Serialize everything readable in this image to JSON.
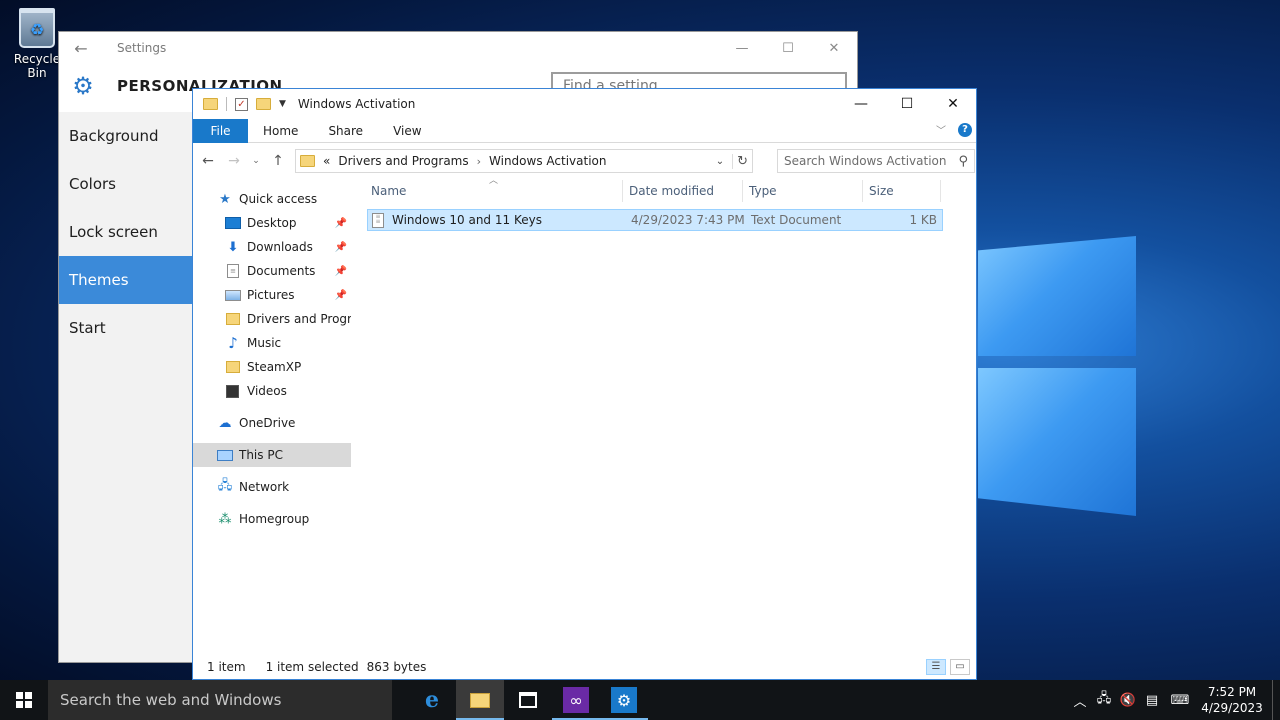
{
  "desktop": {
    "recycle_label": "Recycle Bin"
  },
  "settings": {
    "title": "Settings",
    "heading": "PERSONALIZATION",
    "search_placeholder": "Find a setting",
    "nav": [
      {
        "label": "Background"
      },
      {
        "label": "Colors"
      },
      {
        "label": "Lock screen"
      },
      {
        "label": "Themes",
        "selected": true
      },
      {
        "label": "Start"
      }
    ]
  },
  "explorer": {
    "title": "Windows Activation",
    "ribbon": {
      "file": "File",
      "tabs": [
        "Home",
        "Share",
        "View"
      ],
      "help": "?"
    },
    "address": {
      "overflow": "«",
      "crumbs": [
        "Drivers and Programs",
        "Windows Activation"
      ]
    },
    "search_placeholder": "Search Windows Activation",
    "tree": {
      "quick_access": "Quick access",
      "pinned": [
        "Desktop",
        "Downloads",
        "Documents",
        "Pictures"
      ],
      "folders": [
        "Drivers and Programs",
        "Music",
        "SteamXP",
        "Videos"
      ],
      "onedrive": "OneDrive",
      "this_pc": "This PC",
      "network": "Network",
      "homegroup": "Homegroup"
    },
    "columns": {
      "name": "Name",
      "date": "Date modified",
      "type": "Type",
      "size": "Size"
    },
    "files": [
      {
        "name": "Windows 10 and 11 Keys",
        "date": "4/29/2023 7:43 PM",
        "type": "Text Document",
        "size": "1 KB"
      }
    ],
    "status": {
      "count": "1 item",
      "selected": "1 item selected",
      "bytes": "863 bytes"
    }
  },
  "taskbar": {
    "search_placeholder": "Search the web and Windows",
    "time": "7:52 PM",
    "date": "4/29/2023"
  },
  "colors": {
    "accent": "#1979ca",
    "selection": "#cce8ff",
    "taskbar": "#111417"
  }
}
